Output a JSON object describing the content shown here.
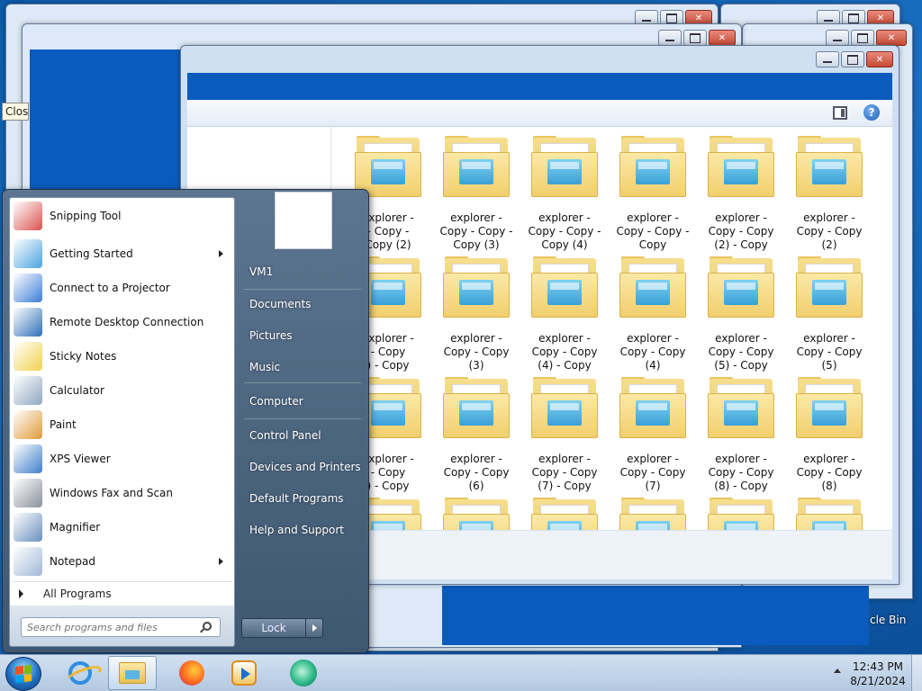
{
  "desktop": {
    "recycle_bin_label": "cle Bin",
    "tooltip_text": "Clos"
  },
  "explorer": {
    "folders": [
      {
        "label": "explorer -\n- Copy -\nCopy (2)"
      },
      {
        "label": "explorer -\nCopy - Copy -\nCopy (3)"
      },
      {
        "label": "explorer -\nCopy - Copy -\nCopy (4)"
      },
      {
        "label": "explorer -\nCopy - Copy -\nCopy"
      },
      {
        "label": "explorer -\nCopy - Copy\n(2) - Copy"
      },
      {
        "label": "explorer -\nCopy - Copy\n(2)"
      },
      {
        "label": "explorer -\n- Copy\n) - Copy"
      },
      {
        "label": "explorer -\nCopy - Copy\n(3)"
      },
      {
        "label": "explorer -\nCopy - Copy\n(4) - Copy"
      },
      {
        "label": "explorer -\nCopy - Copy\n(4)"
      },
      {
        "label": "explorer -\nCopy - Copy\n(5) - Copy"
      },
      {
        "label": "explorer -\nCopy - Copy\n(5)"
      },
      {
        "label": "explorer -\n- Copy\n) - Copy"
      },
      {
        "label": "explorer -\nCopy - Copy\n(6)"
      },
      {
        "label": "explorer -\nCopy - Copy\n(7) - Copy"
      },
      {
        "label": "explorer -\nCopy - Copy\n(7)"
      },
      {
        "label": "explorer -\nCopy - Copy\n(8) - Copy"
      },
      {
        "label": "explorer -\nCopy - Copy\n(8)"
      },
      {
        "label": ""
      },
      {
        "label": ""
      },
      {
        "label": ""
      },
      {
        "label": ""
      },
      {
        "label": ""
      },
      {
        "label": ""
      }
    ]
  },
  "start_menu": {
    "programs": [
      {
        "label": "Snipping Tool",
        "icon": "scissors-icon",
        "submenu": false
      },
      {
        "label": "Getting Started",
        "icon": "getting-started-icon",
        "submenu": true
      },
      {
        "label": "Connect to a Projector",
        "icon": "projector-icon",
        "submenu": false
      },
      {
        "label": "Remote Desktop Connection",
        "icon": "remote-desktop-icon",
        "submenu": false
      },
      {
        "label": "Sticky Notes",
        "icon": "sticky-notes-icon",
        "submenu": false
      },
      {
        "label": "Calculator",
        "icon": "calculator-icon",
        "submenu": false
      },
      {
        "label": "Paint",
        "icon": "paint-palette-icon",
        "submenu": false
      },
      {
        "label": "XPS Viewer",
        "icon": "xps-viewer-icon",
        "submenu": false
      },
      {
        "label": "Windows Fax and Scan",
        "icon": "fax-icon",
        "submenu": false
      },
      {
        "label": "Magnifier",
        "icon": "magnifier-icon",
        "submenu": false
      },
      {
        "label": "Notepad",
        "icon": "notepad-icon",
        "submenu": true
      }
    ],
    "all_programs": "All Programs",
    "search_placeholder": "Search programs and files",
    "right_items": [
      {
        "label": "VM1"
      },
      {
        "label": "Documents"
      },
      {
        "label": "Pictures"
      },
      {
        "label": "Music"
      },
      {
        "label": "Computer"
      },
      {
        "label": "Control Panel"
      },
      {
        "label": "Devices and Printers"
      },
      {
        "label": "Default Programs"
      },
      {
        "label": "Help and Support"
      }
    ],
    "lock_label": "Lock"
  },
  "taskbar": {
    "time": "12:43 PM",
    "date": "8/21/2024"
  },
  "colors": {
    "accent": "#0a5bbd",
    "close_button": "#c44a35",
    "start_menu_right": "#4f6780"
  }
}
